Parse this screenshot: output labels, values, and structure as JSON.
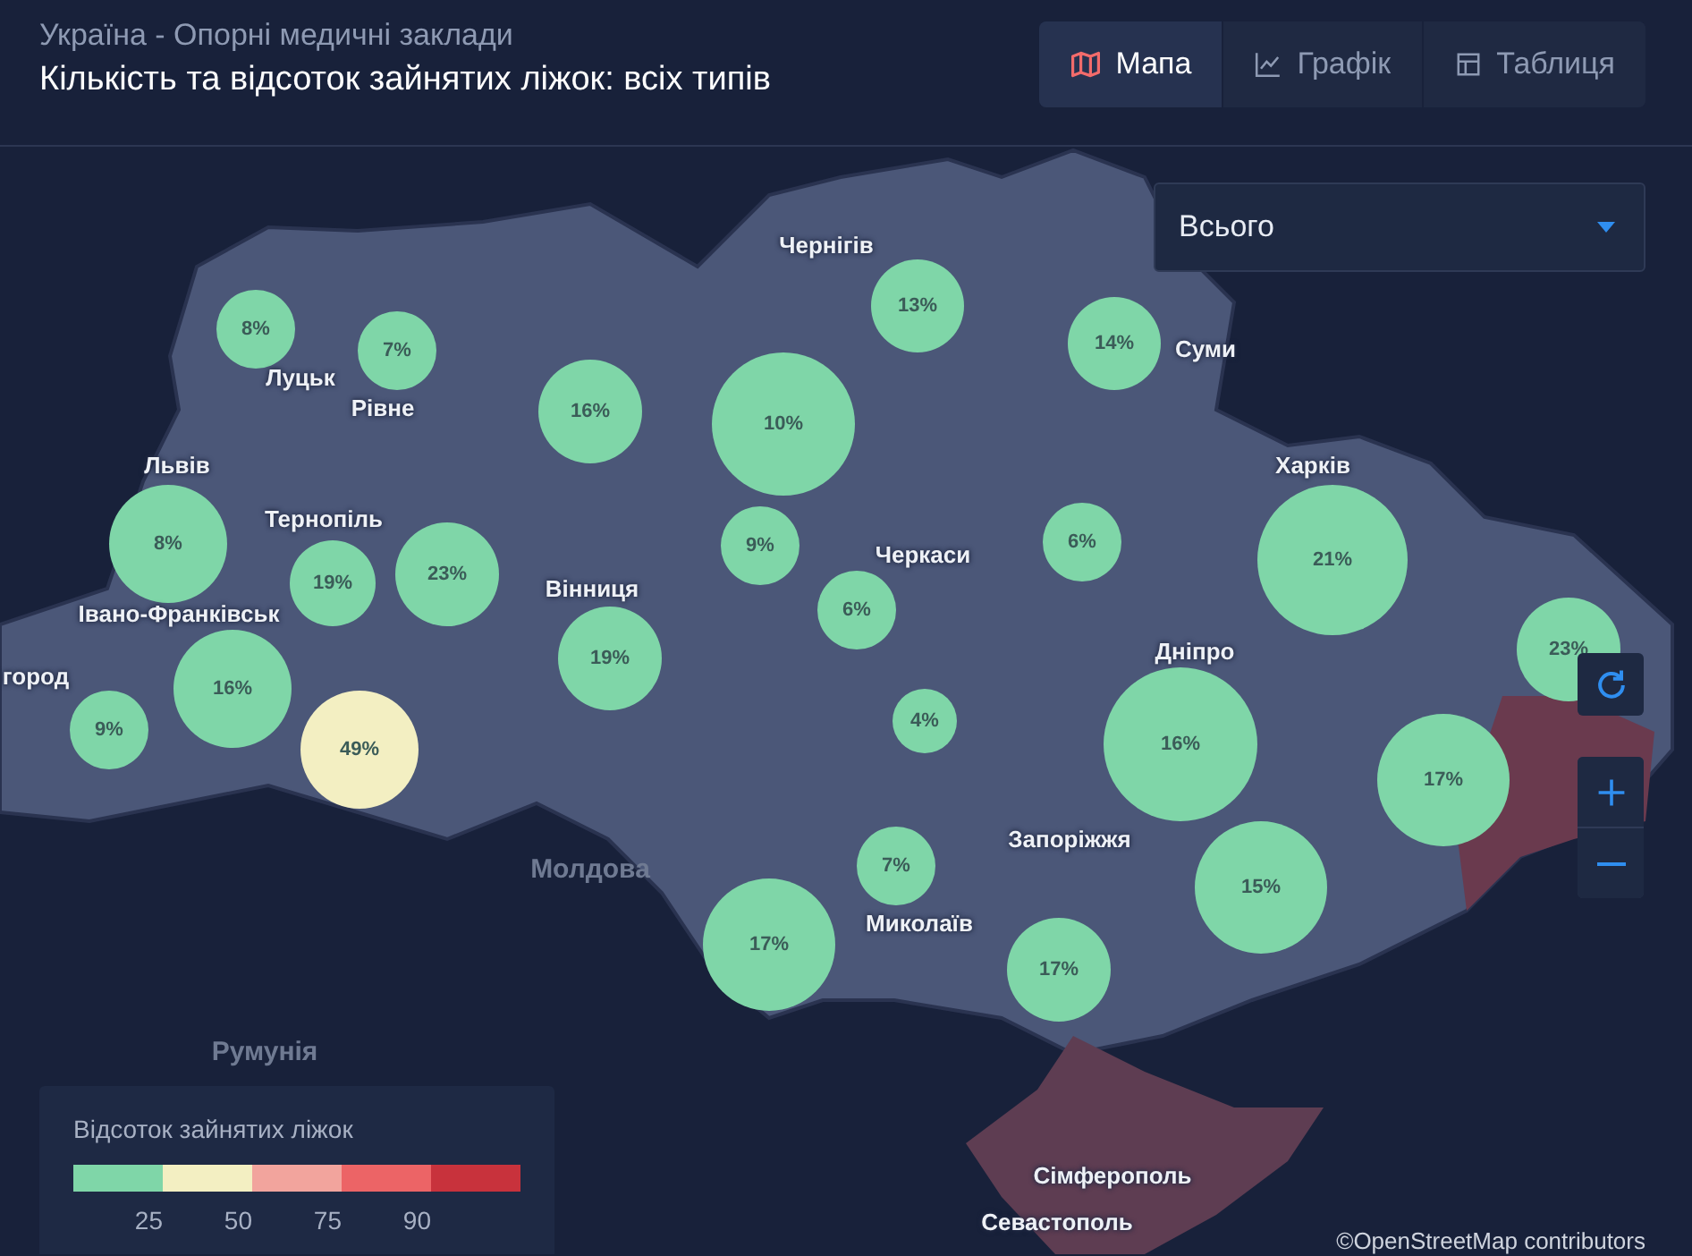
{
  "header": {
    "subtitle": "Україна - Опорні медичні заклади",
    "title": "Кількість та відсоток зайнятих ліжок: всіх типів"
  },
  "tabs": [
    {
      "label": "Мапа",
      "kind": "map",
      "selected": true
    },
    {
      "label": "Графік",
      "kind": "chart",
      "selected": false
    },
    {
      "label": "Таблиця",
      "kind": "table",
      "selected": false
    }
  ],
  "dropdown": {
    "value": "Всього"
  },
  "map": {
    "bubbles": [
      {
        "label": "8%",
        "color": "#7fd6a8"
      },
      {
        "label": "7%",
        "color": "#7fd6a8"
      },
      {
        "label": "16%",
        "color": "#7fd6a8"
      },
      {
        "label": "10%",
        "color": "#7fd6a8"
      },
      {
        "label": "13%",
        "color": "#7fd6a8"
      },
      {
        "label": "14%",
        "color": "#7fd6a8"
      },
      {
        "label": "8%",
        "color": "#7fd6a8"
      },
      {
        "label": "19%",
        "color": "#7fd6a8"
      },
      {
        "label": "23%",
        "color": "#7fd6a8"
      },
      {
        "label": "9%",
        "color": "#7fd6a8"
      },
      {
        "label": "6%",
        "color": "#7fd6a8"
      },
      {
        "label": "6%",
        "color": "#7fd6a8"
      },
      {
        "label": "21%",
        "color": "#7fd6a8"
      },
      {
        "label": "19%",
        "color": "#7fd6a8"
      },
      {
        "label": "16%",
        "color": "#7fd6a8"
      },
      {
        "label": "9%",
        "color": "#7fd6a8"
      },
      {
        "label": "49%",
        "color": "#f3efc2"
      },
      {
        "label": "4%",
        "color": "#7fd6a8"
      },
      {
        "label": "16%",
        "color": "#7fd6a8"
      },
      {
        "label": "23%",
        "color": "#7fd6a8"
      },
      {
        "label": "17%",
        "color": "#7fd6a8"
      },
      {
        "label": "7%",
        "color": "#7fd6a8"
      },
      {
        "label": "15%",
        "color": "#7fd6a8"
      },
      {
        "label": "17%",
        "color": "#7fd6a8"
      },
      {
        "label": "17%",
        "color": "#7fd6a8"
      }
    ],
    "places": [
      {
        "name": "Чернігів",
        "kind": "city"
      },
      {
        "name": "Суми",
        "kind": "city"
      },
      {
        "name": "Луцьк",
        "kind": "city"
      },
      {
        "name": "Рівне",
        "kind": "city"
      },
      {
        "name": "Харків",
        "kind": "city"
      },
      {
        "name": "Львів",
        "kind": "city"
      },
      {
        "name": "Тернопіль",
        "kind": "city"
      },
      {
        "name": "Черкаси",
        "kind": "city"
      },
      {
        "name": "Вінниця",
        "kind": "city"
      },
      {
        "name": "Івано-Франківськ",
        "kind": "city"
      },
      {
        "name": "город",
        "kind": "city"
      },
      {
        "name": "Дніпро",
        "kind": "city"
      },
      {
        "name": "Запоріжжя",
        "kind": "city"
      },
      {
        "name": "Молдова",
        "kind": "country"
      },
      {
        "name": "Миколаїв",
        "kind": "city"
      },
      {
        "name": "Румунія",
        "kind": "country"
      },
      {
        "name": "Сімферополь",
        "kind": "city"
      },
      {
        "name": "Севастополь",
        "kind": "city"
      }
    ],
    "attribution": "©OpenStreetMap contributors"
  },
  "legend": {
    "title": "Відсоток зайнятих ліжок",
    "segments": [
      {
        "color": "#7fd6a8"
      },
      {
        "color": "#f3efc2"
      },
      {
        "color": "#f2a49d"
      },
      {
        "color": "#ec6466"
      },
      {
        "color": "#c8323c"
      }
    ],
    "ticks": [
      "25",
      "50",
      "75",
      "90"
    ]
  }
}
